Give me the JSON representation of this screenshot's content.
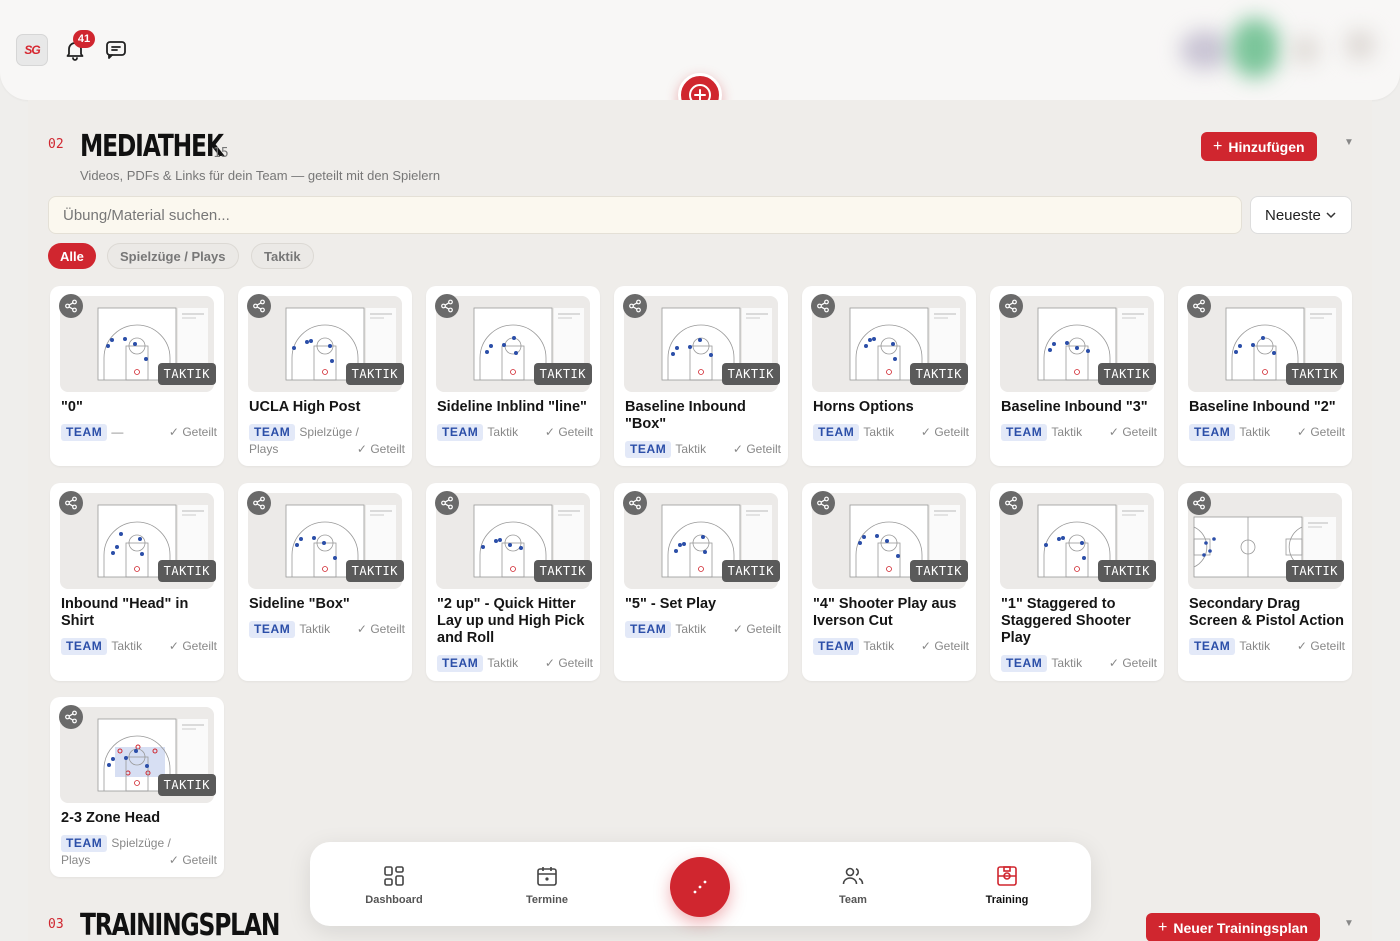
{
  "header": {
    "logo_text": "SG",
    "notifications_count": "41"
  },
  "mediathek": {
    "number": "02",
    "title": "MEDIATHEK",
    "count": "15",
    "subtitle": "Videos, PDFs & Links für dein Team — geteilt mit den Spielern",
    "add_button": "Hinzufügen",
    "search_placeholder": "Übung/Material suchen...",
    "sort_value": "Neueste",
    "filters": [
      "Alle",
      "Spielzüge / Plays",
      "Taktik"
    ]
  },
  "cards": [
    {
      "title": "\"0\"",
      "team": "TEAM",
      "type": "—",
      "shared": "Geteilt",
      "badge": "TAKTIK"
    },
    {
      "title": "UCLA High Post",
      "team": "TEAM",
      "type": "Spielzüge / Plays",
      "shared": "Geteilt",
      "badge": "TAKTIK"
    },
    {
      "title": "Sideline Inblind \"line\"",
      "team": "TEAM",
      "type": "Taktik",
      "shared": "Geteilt",
      "badge": "TAKTIK"
    },
    {
      "title": "Baseline Inbound \"Box\"",
      "team": "TEAM",
      "type": "Taktik",
      "shared": "Geteilt",
      "badge": "TAKTIK"
    },
    {
      "title": "Horns Options",
      "team": "TEAM",
      "type": "Taktik",
      "shared": "Geteilt",
      "badge": "TAKTIK"
    },
    {
      "title": "Baseline Inbound \"3\"",
      "team": "TEAM",
      "type": "Taktik",
      "shared": "Geteilt",
      "badge": "TAKTIK"
    },
    {
      "title": "Baseline Inbound \"2\"",
      "team": "TEAM",
      "type": "Taktik",
      "shared": "Geteilt",
      "badge": "TAKTIK"
    },
    {
      "title": "Inbound \"Head\" in Shirt",
      "team": "TEAM",
      "type": "Taktik",
      "shared": "Geteilt",
      "badge": "TAKTIK"
    },
    {
      "title": "Sideline \"Box\"",
      "team": "TEAM",
      "type": "Taktik",
      "shared": "Geteilt",
      "badge": "TAKTIK"
    },
    {
      "title": "\"2 up\" - Quick Hitter Lay up und High Pick and Roll",
      "team": "TEAM",
      "type": "Taktik",
      "shared": "Geteilt",
      "badge": "TAKTIK"
    },
    {
      "title": "\"5\" - Set Play",
      "team": "TEAM",
      "type": "Taktik",
      "shared": "Geteilt",
      "badge": "TAKTIK"
    },
    {
      "title": "\"4\" Shooter Play aus Iverson Cut",
      "team": "TEAM",
      "type": "Taktik",
      "shared": "Geteilt",
      "badge": "TAKTIK"
    },
    {
      "title": "\"1\" Staggered to Staggered Shooter Play",
      "team": "TEAM",
      "type": "Taktik",
      "shared": "Geteilt",
      "badge": "TAKTIK"
    },
    {
      "title": "Secondary Drag Screen & Pistol Action",
      "team": "TEAM",
      "type": "Taktik",
      "shared": "Geteilt",
      "badge": "TAKTIK"
    },
    {
      "title": "2-3 Zone Head",
      "team": "TEAM",
      "type": "Spielzüge / Plays",
      "shared": "Geteilt",
      "badge": "TAKTIK"
    }
  ],
  "trainingsplan": {
    "number": "03",
    "title": "TRAININGSPLAN",
    "new_button": "Neuer Trainingsplan"
  },
  "nav": {
    "dashboard": "Dashboard",
    "termine": "Termine",
    "team": "Team",
    "training": "Training"
  },
  "colors": {
    "accent": "#d0262f",
    "team_badge_bg": "#e3e9f8",
    "team_badge_text": "#2b4ea8"
  }
}
